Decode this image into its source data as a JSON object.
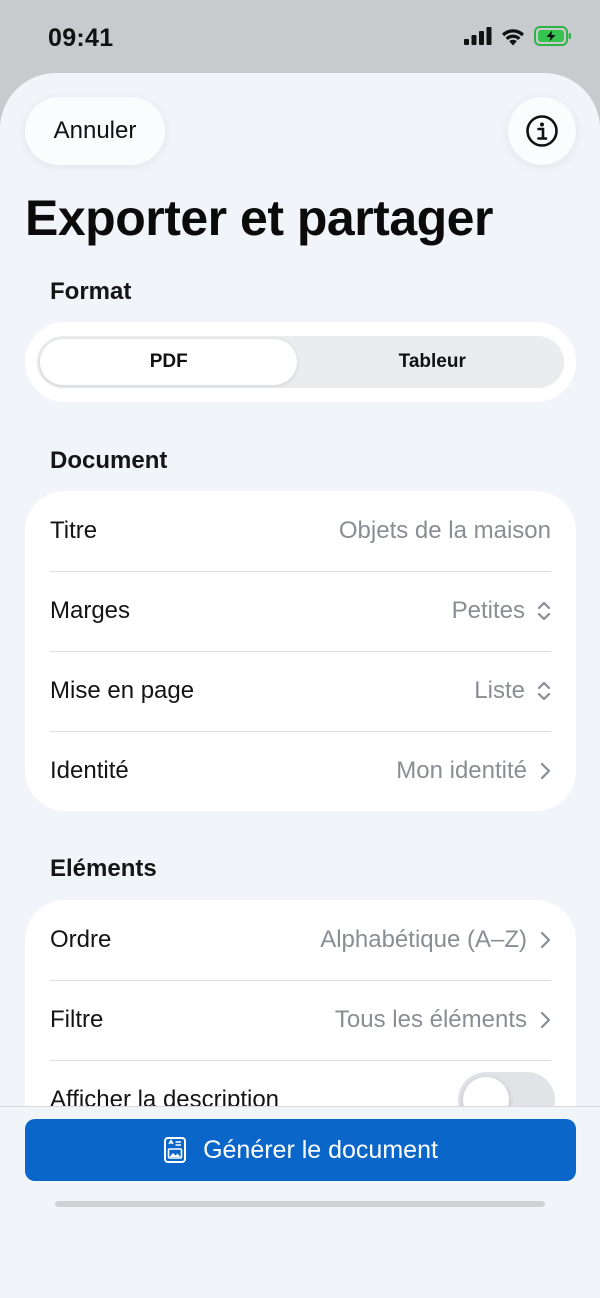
{
  "status_bar": {
    "time": "09:41"
  },
  "header": {
    "cancel_label": "Annuler",
    "title": "Exporter et partager"
  },
  "format": {
    "section_label": "Format",
    "options": [
      "PDF",
      "Tableur"
    ],
    "selected": "PDF"
  },
  "document": {
    "section_label": "Document",
    "rows": [
      {
        "label": "Titre",
        "value": "Objets de la maison",
        "accessory": "none"
      },
      {
        "label": "Marges",
        "value": "Petites",
        "accessory": "updown"
      },
      {
        "label": "Mise en page",
        "value": "Liste",
        "accessory": "updown"
      },
      {
        "label": "Identité",
        "value": "Mon identité",
        "accessory": "chevron"
      }
    ]
  },
  "elements": {
    "section_label": "Eléments",
    "rows": [
      {
        "label": "Ordre",
        "value": "Alphabétique (A–Z)",
        "accessory": "chevron"
      },
      {
        "label": "Filtre",
        "value": "Tous les éléments",
        "accessory": "chevron"
      }
    ],
    "toggle_row": {
      "label": "Afficher la description",
      "on": false
    }
  },
  "footer": {
    "generate_label": "Générer le document"
  },
  "colors": {
    "accent": "#0a67c9",
    "background": "#f1f4f9",
    "secondary_text": "#8a8d93"
  }
}
